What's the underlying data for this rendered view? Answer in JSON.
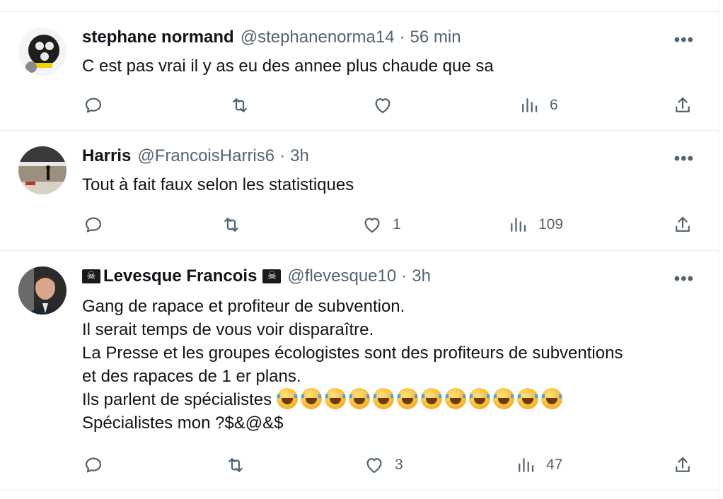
{
  "tweets": [
    {
      "name": "stephane normand",
      "handle": "@stephanenorma14",
      "separator": "·",
      "time": "56 min",
      "body": "C est pas vrai il y as eu des annee plus chaude que sa",
      "replies": "",
      "retweets": "",
      "likes": "",
      "views": "6"
    },
    {
      "name": "Harris",
      "handle": "@FrancoisHarris6",
      "separator": "·",
      "time": "3h",
      "body": "Tout à fait faux selon les statistiques",
      "replies": "",
      "retweets": "",
      "likes": "1",
      "views": "109"
    },
    {
      "name_prefix_icon": "pirate-flag-icon",
      "name": "Levesque Francois",
      "name_suffix_icon": "pirate-flag-icon",
      "handle": "@flevesque10",
      "separator": "·",
      "time": "3h",
      "body_lines": [
        "Gang de rapace et profiteur de subvention.",
        "Il serait temps de vous voir disparaître.",
        "La Presse et les groupes écologistes sont des profiteurs de subventions",
        "et des rapaces de 1 er plans.",
        "Ils parlent de spécialistes",
        "Spécialistes mon ?$&@&$"
      ],
      "emoji_count": 12,
      "emoji_icon": "tears-of-joy-emoji",
      "replies": "",
      "retweets": "",
      "likes": "3",
      "views": "47"
    }
  ],
  "icons": {
    "more": "more-dots-icon",
    "reply": "reply-icon",
    "retweet": "retweet-icon",
    "like": "heart-icon",
    "views": "views-chart-icon",
    "share": "share-icon"
  },
  "colors": {
    "text": "#0f1419",
    "secondary": "#536471",
    "divider": "#e6ecf0"
  },
  "more_label": "•••"
}
